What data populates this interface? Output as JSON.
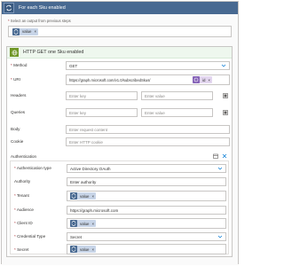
{
  "foreach": {
    "title": "For each Sku enabled",
    "output_label": "Select an output from previous steps",
    "output_token": "value",
    "token_remove": "×"
  },
  "http": {
    "title": "HTTP GET one Sku enabled",
    "method": {
      "label": "Method",
      "value": "GET"
    },
    "uri": {
      "label": "URI",
      "value": "https://graph.microsoft.com/v1.0/subscribedSkus/",
      "token": "id"
    },
    "headers": {
      "label": "Headers",
      "key_placeholder": "Enter key",
      "value_placeholder": "Enter value"
    },
    "queries": {
      "label": "Queries",
      "key_placeholder": "Enter key",
      "value_placeholder": "Enter value"
    },
    "body": {
      "label": "Body",
      "placeholder": "Enter request content"
    },
    "cookie": {
      "label": "Cookie",
      "placeholder": "Enter HTTP cookie"
    },
    "authentication": {
      "label": "Authentication",
      "type": {
        "label": "Authentication type",
        "value": "Active Directory OAuth"
      },
      "authority": {
        "label": "Authority",
        "placeholder": "Enter authority"
      },
      "tenant": {
        "label": "Tenant",
        "token": "value"
      },
      "audience": {
        "label": "Audience",
        "value": "https://graph.microsoft.com"
      },
      "client_id": {
        "label": "Client ID",
        "token": "value"
      },
      "credential_type": {
        "label": "Credential Type",
        "value": "Secret"
      },
      "secret": {
        "label": "Secret",
        "token": "value"
      }
    }
  },
  "colors": {
    "foreach_header": "#486991",
    "http_icon": "#709727",
    "token_blue": "#c8d5e8",
    "token_purple": "#e3d6ef",
    "required": "#a4262c"
  }
}
